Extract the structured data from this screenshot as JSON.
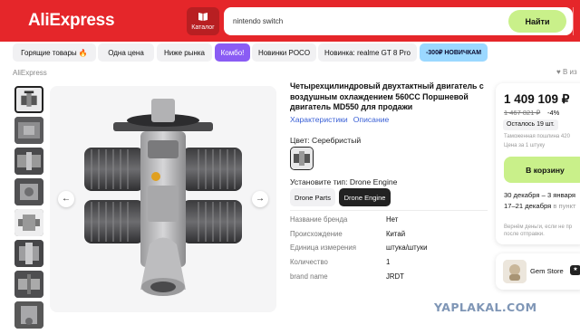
{
  "header": {
    "logo": "AliExpress",
    "catalog_label": "Каталог",
    "search_value": "nintendo switch",
    "search_button": "Найти"
  },
  "chips": [
    "Горящие товары 🔥",
    "Одна цена",
    "Ниже рынка",
    "Комбо!",
    "Новинки POCO",
    "Новинка: realme GT 8 Pro",
    "-300₽ НОВИЧКАМ"
  ],
  "breadcrumb": "AliExpress",
  "favorite_label": "В из",
  "product": {
    "title": "Четырехцилиндровый двухтактный двигатель с воздушным охлаждением 560CC Поршневой двигатель MD550 для продажи",
    "links": [
      "Характеристики",
      "Описание"
    ],
    "color_label": "Цвет: Серебристый",
    "type_label": "Установите тип: Drone Engine",
    "type_options": [
      "Drone Parts",
      "Drone Engine"
    ],
    "selected_type": "Drone Engine",
    "specs": [
      {
        "key": "Название бренда",
        "value": "Нет"
      },
      {
        "key": "Происхождение",
        "value": "Китай"
      },
      {
        "key": "Единица измерения",
        "value": "штука/штуки"
      },
      {
        "key": "Количество",
        "value": "1"
      },
      {
        "key": "brand name",
        "value": "JRDT"
      }
    ]
  },
  "buybox": {
    "price": "1 409 109 ₽",
    "old_price": "1 467 821 ₽",
    "discount": "-4%",
    "stock": "Осталось 19 шт.",
    "duty": "Таможенная пошлина 420",
    "unit": "Цена за 1 штуку",
    "cart_button": "В корзину",
    "delivery_main": "30 декабря – 3 января",
    "delivery_pickup_dates": "17–21 декабря",
    "delivery_pickup_suffix": "в пункт",
    "refund": "Вернём деньги, если не пр после отправки."
  },
  "store": {
    "name": "Gem Store",
    "badge": "★"
  },
  "watermark": "YAPLAKAL.COM",
  "colors": {
    "brand_red": "#e5262a",
    "lime": "#c9f08a",
    "purple_chip": "#8a5cf4",
    "blue_chip": "#9bd8ff",
    "link_blue": "#3b61d6"
  }
}
